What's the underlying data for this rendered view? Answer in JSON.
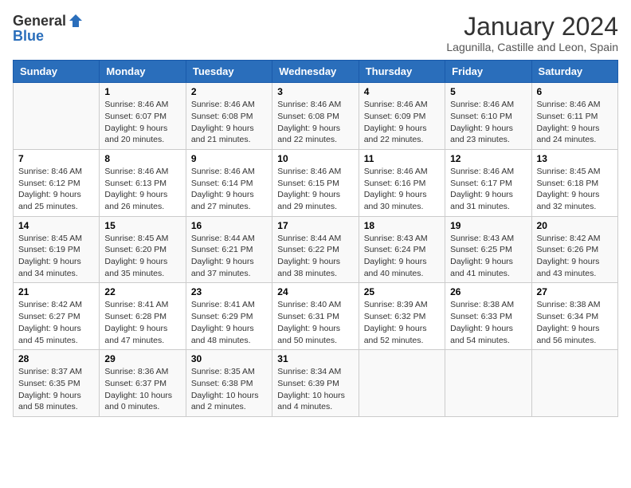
{
  "logo": {
    "general": "General",
    "blue": "Blue"
  },
  "title": "January 2024",
  "subtitle": "Lagunilla, Castille and Leon, Spain",
  "days": [
    "Sunday",
    "Monday",
    "Tuesday",
    "Wednesday",
    "Thursday",
    "Friday",
    "Saturday"
  ],
  "weeks": [
    [
      {
        "day": "",
        "sunrise": "",
        "sunset": "",
        "daylight": ""
      },
      {
        "day": "1",
        "sunrise": "Sunrise: 8:46 AM",
        "sunset": "Sunset: 6:07 PM",
        "daylight": "Daylight: 9 hours and 20 minutes."
      },
      {
        "day": "2",
        "sunrise": "Sunrise: 8:46 AM",
        "sunset": "Sunset: 6:08 PM",
        "daylight": "Daylight: 9 hours and 21 minutes."
      },
      {
        "day": "3",
        "sunrise": "Sunrise: 8:46 AM",
        "sunset": "Sunset: 6:08 PM",
        "daylight": "Daylight: 9 hours and 22 minutes."
      },
      {
        "day": "4",
        "sunrise": "Sunrise: 8:46 AM",
        "sunset": "Sunset: 6:09 PM",
        "daylight": "Daylight: 9 hours and 22 minutes."
      },
      {
        "day": "5",
        "sunrise": "Sunrise: 8:46 AM",
        "sunset": "Sunset: 6:10 PM",
        "daylight": "Daylight: 9 hours and 23 minutes."
      },
      {
        "day": "6",
        "sunrise": "Sunrise: 8:46 AM",
        "sunset": "Sunset: 6:11 PM",
        "daylight": "Daylight: 9 hours and 24 minutes."
      }
    ],
    [
      {
        "day": "7",
        "sunrise": "Sunrise: 8:46 AM",
        "sunset": "Sunset: 6:12 PM",
        "daylight": "Daylight: 9 hours and 25 minutes."
      },
      {
        "day": "8",
        "sunrise": "Sunrise: 8:46 AM",
        "sunset": "Sunset: 6:13 PM",
        "daylight": "Daylight: 9 hours and 26 minutes."
      },
      {
        "day": "9",
        "sunrise": "Sunrise: 8:46 AM",
        "sunset": "Sunset: 6:14 PM",
        "daylight": "Daylight: 9 hours and 27 minutes."
      },
      {
        "day": "10",
        "sunrise": "Sunrise: 8:46 AM",
        "sunset": "Sunset: 6:15 PM",
        "daylight": "Daylight: 9 hours and 29 minutes."
      },
      {
        "day": "11",
        "sunrise": "Sunrise: 8:46 AM",
        "sunset": "Sunset: 6:16 PM",
        "daylight": "Daylight: 9 hours and 30 minutes."
      },
      {
        "day": "12",
        "sunrise": "Sunrise: 8:46 AM",
        "sunset": "Sunset: 6:17 PM",
        "daylight": "Daylight: 9 hours and 31 minutes."
      },
      {
        "day": "13",
        "sunrise": "Sunrise: 8:45 AM",
        "sunset": "Sunset: 6:18 PM",
        "daylight": "Daylight: 9 hours and 32 minutes."
      }
    ],
    [
      {
        "day": "14",
        "sunrise": "Sunrise: 8:45 AM",
        "sunset": "Sunset: 6:19 PM",
        "daylight": "Daylight: 9 hours and 34 minutes."
      },
      {
        "day": "15",
        "sunrise": "Sunrise: 8:45 AM",
        "sunset": "Sunset: 6:20 PM",
        "daylight": "Daylight: 9 hours and 35 minutes."
      },
      {
        "day": "16",
        "sunrise": "Sunrise: 8:44 AM",
        "sunset": "Sunset: 6:21 PM",
        "daylight": "Daylight: 9 hours and 37 minutes."
      },
      {
        "day": "17",
        "sunrise": "Sunrise: 8:44 AM",
        "sunset": "Sunset: 6:22 PM",
        "daylight": "Daylight: 9 hours and 38 minutes."
      },
      {
        "day": "18",
        "sunrise": "Sunrise: 8:43 AM",
        "sunset": "Sunset: 6:24 PM",
        "daylight": "Daylight: 9 hours and 40 minutes."
      },
      {
        "day": "19",
        "sunrise": "Sunrise: 8:43 AM",
        "sunset": "Sunset: 6:25 PM",
        "daylight": "Daylight: 9 hours and 41 minutes."
      },
      {
        "day": "20",
        "sunrise": "Sunrise: 8:42 AM",
        "sunset": "Sunset: 6:26 PM",
        "daylight": "Daylight: 9 hours and 43 minutes."
      }
    ],
    [
      {
        "day": "21",
        "sunrise": "Sunrise: 8:42 AM",
        "sunset": "Sunset: 6:27 PM",
        "daylight": "Daylight: 9 hours and 45 minutes."
      },
      {
        "day": "22",
        "sunrise": "Sunrise: 8:41 AM",
        "sunset": "Sunset: 6:28 PM",
        "daylight": "Daylight: 9 hours and 47 minutes."
      },
      {
        "day": "23",
        "sunrise": "Sunrise: 8:41 AM",
        "sunset": "Sunset: 6:29 PM",
        "daylight": "Daylight: 9 hours and 48 minutes."
      },
      {
        "day": "24",
        "sunrise": "Sunrise: 8:40 AM",
        "sunset": "Sunset: 6:31 PM",
        "daylight": "Daylight: 9 hours and 50 minutes."
      },
      {
        "day": "25",
        "sunrise": "Sunrise: 8:39 AM",
        "sunset": "Sunset: 6:32 PM",
        "daylight": "Daylight: 9 hours and 52 minutes."
      },
      {
        "day": "26",
        "sunrise": "Sunrise: 8:38 AM",
        "sunset": "Sunset: 6:33 PM",
        "daylight": "Daylight: 9 hours and 54 minutes."
      },
      {
        "day": "27",
        "sunrise": "Sunrise: 8:38 AM",
        "sunset": "Sunset: 6:34 PM",
        "daylight": "Daylight: 9 hours and 56 minutes."
      }
    ],
    [
      {
        "day": "28",
        "sunrise": "Sunrise: 8:37 AM",
        "sunset": "Sunset: 6:35 PM",
        "daylight": "Daylight: 9 hours and 58 minutes."
      },
      {
        "day": "29",
        "sunrise": "Sunrise: 8:36 AM",
        "sunset": "Sunset: 6:37 PM",
        "daylight": "Daylight: 10 hours and 0 minutes."
      },
      {
        "day": "30",
        "sunrise": "Sunrise: 8:35 AM",
        "sunset": "Sunset: 6:38 PM",
        "daylight": "Daylight: 10 hours and 2 minutes."
      },
      {
        "day": "31",
        "sunrise": "Sunrise: 8:34 AM",
        "sunset": "Sunset: 6:39 PM",
        "daylight": "Daylight: 10 hours and 4 minutes."
      },
      {
        "day": "",
        "sunrise": "",
        "sunset": "",
        "daylight": ""
      },
      {
        "day": "",
        "sunrise": "",
        "sunset": "",
        "daylight": ""
      },
      {
        "day": "",
        "sunrise": "",
        "sunset": "",
        "daylight": ""
      }
    ]
  ]
}
